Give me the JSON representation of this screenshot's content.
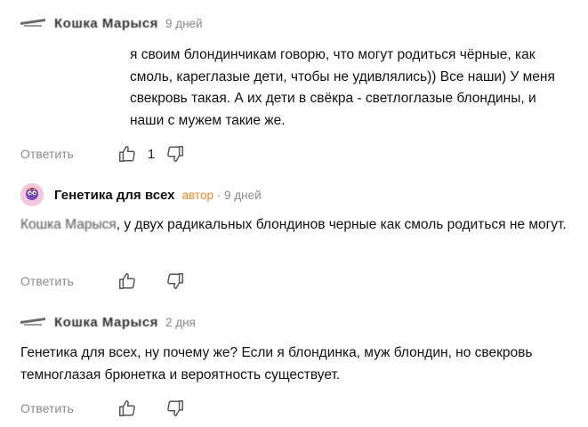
{
  "comments": [
    {
      "author": "Кошка Марыся",
      "time": "9 дней",
      "blurred_lead": "",
      "text": "я своим блондинчикам говорю, что могут родиться чёрные, как смоль, кареглазые дети, чтобы не удивлялись)) Все наши) У меня свекровь такая. А их дети в свёкра - светлоглазые блондины, и наши с мужем такие же.",
      "reply_label": "Ответить",
      "likes": "1"
    },
    {
      "author": "Генетика для всех",
      "role": "автор",
      "separator": "·",
      "time": "9 дней",
      "blurred_lead": "Кошка Марыся",
      "text": ", у двух радикальных блондинов черные как смоль родиться не могут.",
      "reply_label": "Ответить",
      "likes": ""
    },
    {
      "author": "Кошка Марыся",
      "time": "2 дня",
      "text": "Генетика для всех, ну почему же? Если я блондинка, муж блондин, но свекровь темноглазая брюнетка и вероятность существует.",
      "reply_label": "Ответить",
      "likes": ""
    }
  ],
  "icons": {
    "like": "thumbs-up-icon",
    "dislike": "thumbs-down-icon"
  },
  "colors": {
    "meta": "#8a8a8a",
    "author_role": "#f08a2f"
  }
}
